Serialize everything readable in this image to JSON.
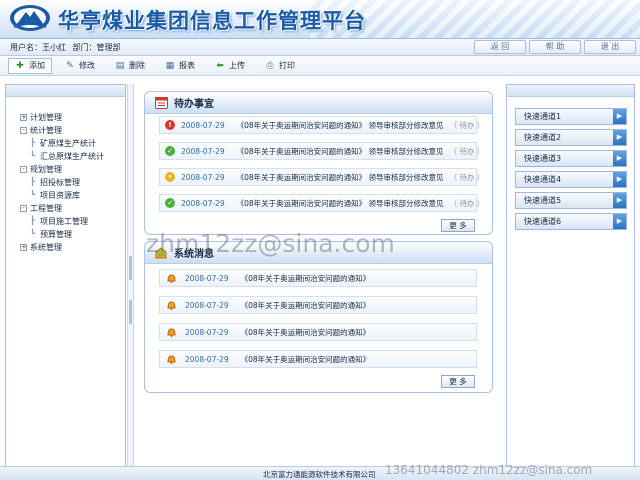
{
  "app": {
    "title": "华亭煤业集团信息工作管理平台"
  },
  "userbar": {
    "user_label": "用户名：王小红",
    "dept_label": "部门：管理部",
    "nav": [
      "返 回",
      "帮 助",
      "退 出"
    ]
  },
  "toolbar": {
    "buttons": [
      {
        "label": "添加",
        "icon": "add-icon"
      },
      {
        "label": "修改",
        "icon": "edit-icon"
      },
      {
        "label": "删除",
        "icon": "delete-icon"
      },
      {
        "label": "报表",
        "icon": "report-icon"
      },
      {
        "label": "上传",
        "icon": "upload-icon"
      },
      {
        "label": "打印",
        "icon": "print-icon"
      }
    ]
  },
  "sidebar": {
    "tree": [
      {
        "label": "计划管理",
        "level": 0,
        "toggle": "+"
      },
      {
        "label": "统计管理",
        "level": 0,
        "toggle": "-"
      },
      {
        "label": "矿原煤生产统计",
        "level": 1
      },
      {
        "label": "汇总原煤生产统计",
        "level": 1
      },
      {
        "label": "规划管理",
        "level": 0,
        "toggle": "-"
      },
      {
        "label": "招投标管理",
        "level": 1
      },
      {
        "label": "项目资源库",
        "level": 1
      },
      {
        "label": "工程管理",
        "level": 0,
        "toggle": "-"
      },
      {
        "label": "项目施工管理",
        "level": 1
      },
      {
        "label": "预算管理",
        "level": 1
      },
      {
        "label": "系统管理",
        "level": 0,
        "toggle": "+"
      }
    ]
  },
  "todo": {
    "title": "待办事宜",
    "more_label": "更 多",
    "items": [
      {
        "date": "2008-07-29",
        "text": "《08年关于奥运期间治安问题的通知》 领导审核部分修改意见",
        "status": "（ 待办 ）",
        "icon_color": "#d9362b"
      },
      {
        "date": "2008-07-29",
        "text": "《08年关于奥运期间治安问题的通知》 领导审核部分修改意见",
        "status": "（ 待办 ）",
        "icon_color": "#4caf3c"
      },
      {
        "date": "2008-07-29",
        "text": "《08年关于奥运期间治安问题的通知》 领导审核部分修改意见",
        "status": "（ 待办 ）",
        "icon_color": "#e8b421"
      },
      {
        "date": "2008-07-29",
        "text": "《08年关于奥运期间治安问题的通知》 领导审核部分修改意见",
        "status": "（ 待办 ）",
        "icon_color": "#4caf3c"
      }
    ]
  },
  "news": {
    "title": "系统消息",
    "more_label": "更 多",
    "items": [
      {
        "date": "2008-07-29",
        "text": "《08年关于奥运期间治安问题的通知》"
      },
      {
        "date": "2008-07-29",
        "text": "《08年关于奥运期间治安问题的通知》"
      },
      {
        "date": "2008-07-29",
        "text": "《08年关于奥运期间治安问题的通知》"
      },
      {
        "date": "2008-07-29",
        "text": "《08年关于奥运期间治安问题的通知》"
      }
    ]
  },
  "quick": {
    "items": [
      "快速通道1",
      "快速通道2",
      "快速通道3",
      "快速通道4",
      "快速通道5",
      "快速通道6"
    ]
  },
  "footer": {
    "company": "北京富力通能源软件技术有限公司"
  },
  "watermarks": {
    "center": "zhm12zz@sina.com",
    "bottom": "13641044802  zhm12zz@sina.com"
  }
}
